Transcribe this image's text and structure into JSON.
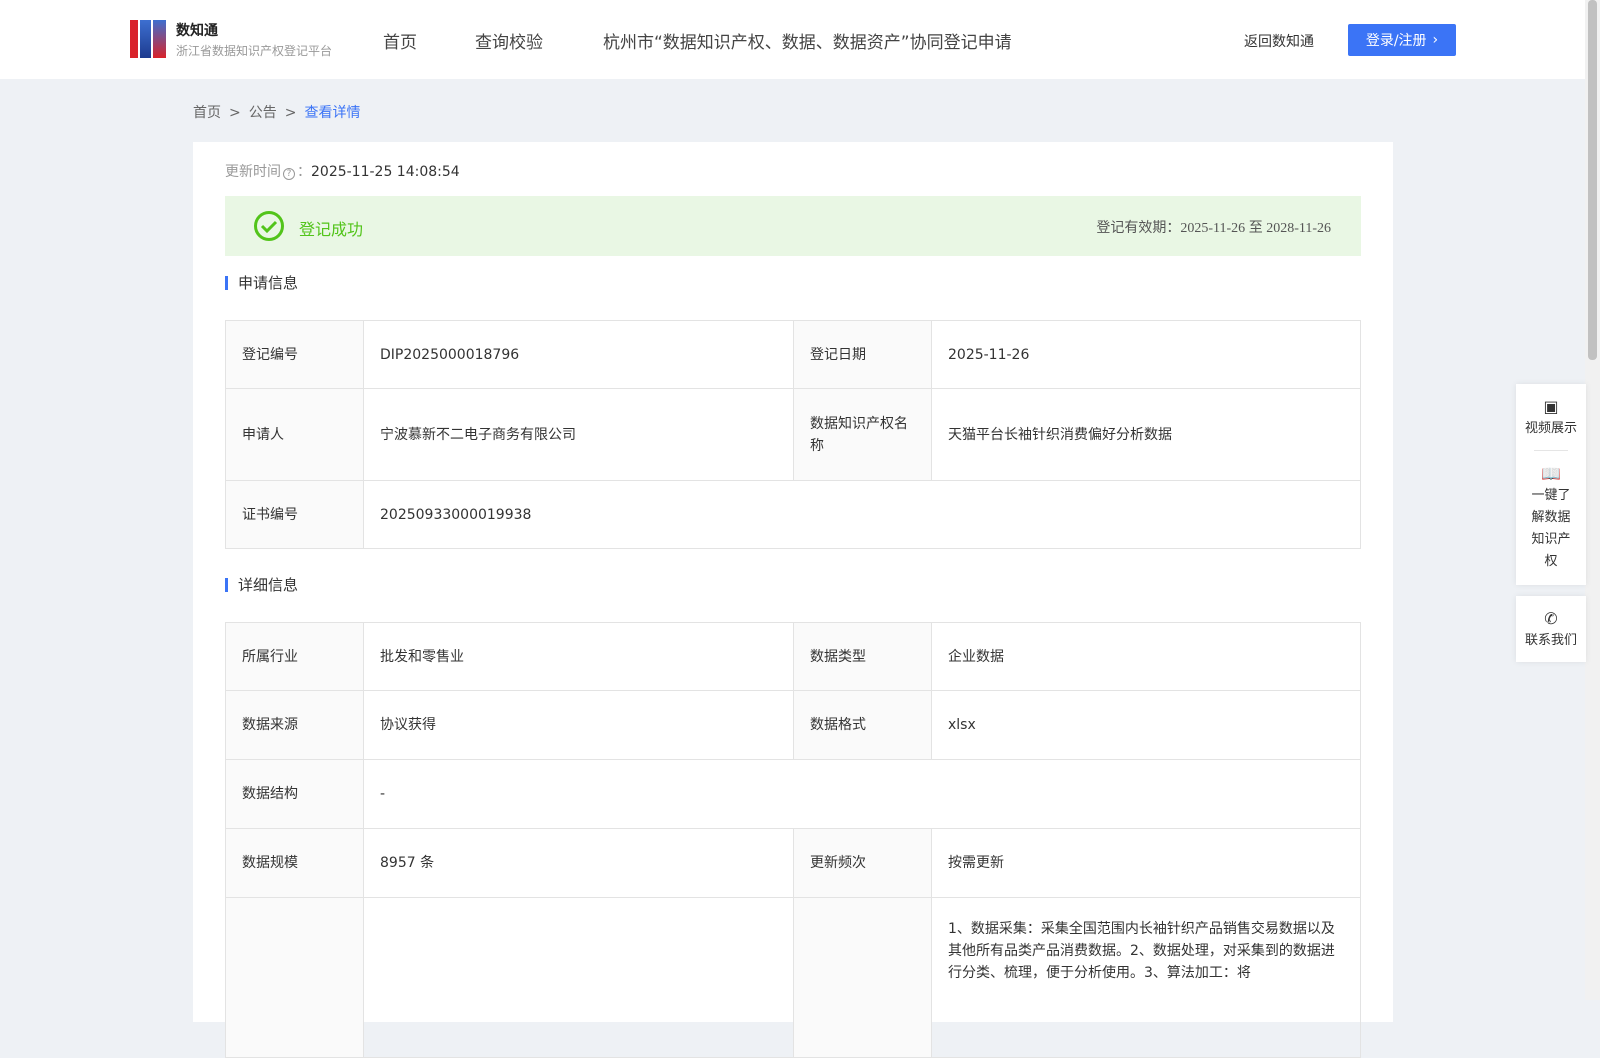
{
  "header": {
    "brand_name": "数知通",
    "brand_sub": "浙江省数据知识产权登记平台",
    "nav": [
      "首页",
      "查询校验",
      "杭州市“数据知识产权、数据、数据资产”协同登记申请"
    ],
    "back": "返回数知通",
    "login": "登录/注册"
  },
  "breadcrumb": [
    "首页",
    "公告",
    "查看详情"
  ],
  "update": {
    "label": "更新时间",
    "value": "2025-11-25 14:08:54"
  },
  "status": {
    "text": "登记成功",
    "valid_label": "登记有效期：",
    "valid_from": "2025-11-26",
    "to": "至",
    "valid_to": "2028-11-26",
    "color": "#52c41a"
  },
  "apply": {
    "title": "申请信息",
    "rows": [
      {
        "k1": "登记编号",
        "v1": "DIP2025000018796",
        "k2": "登记日期",
        "v2": "2025-11-26"
      },
      {
        "k1": "申请人",
        "v1": "宁波慕新不二电子商务有限公司",
        "k2": "数据知识产权名称",
        "v2": "天猫平台长袖针织消费偏好分析数据"
      },
      {
        "k1": "证书编号",
        "v1": "20250933000019938"
      }
    ]
  },
  "detail": {
    "title": "详细信息",
    "rows": [
      {
        "k1": "所属行业",
        "v1": "批发和零售业",
        "k2": "数据类型",
        "v2": "企业数据"
      },
      {
        "k1": "数据来源",
        "v1": "协议获得",
        "k2": "数据格式",
        "v2": "xlsx"
      },
      {
        "k1": "数据结构",
        "v1": "-"
      },
      {
        "k1": "数据规模",
        "v1": "8957 条",
        "k2": "更新频次",
        "v2": "按需更新"
      },
      {
        "k1": "",
        "v1": "",
        "k2": "",
        "v2": "1、数据采集：采集全国范围内长袖针织产品销售交易数据以及其他所有品类产品消费数据。2、数据处理，对采集到的数据进行分类、梳理，便于分析使用。3、算法加工：将"
      }
    ]
  },
  "side": {
    "video": "视频展示",
    "learn": "一键了解数据知识产权",
    "contact": "联系我们"
  },
  "accent": "#3b74f6"
}
